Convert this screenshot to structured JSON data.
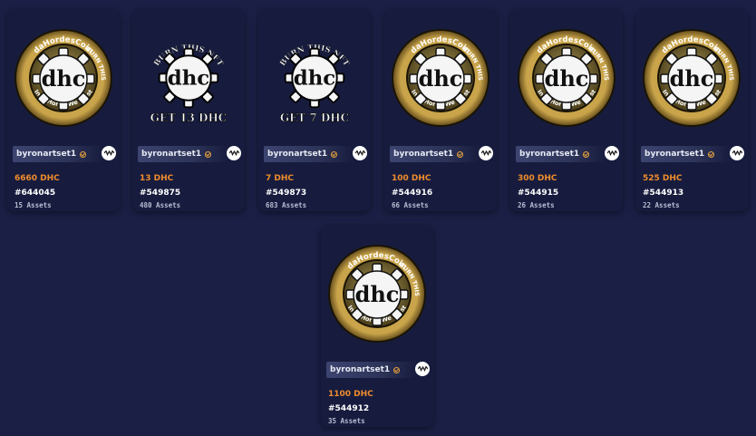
{
  "colors": {
    "background": "#1b1f45",
    "card": "#171c3e",
    "price": "#f08c2c",
    "verified": "#e8a33a"
  },
  "cards": [
    {
      "author": "byronartset1",
      "price": "6660 DHC",
      "template": "#644045",
      "assets": "15 Assets",
      "image": "gold-dhc-coin",
      "coin_top": "daHordesCoin",
      "coin_side": "BURN THIS",
      "coin_bottom": "In daHorde We Trust"
    },
    {
      "author": "byronartset1",
      "price": "13 DHC",
      "template": "#549875",
      "assets": "480 Assets",
      "image": "bw-dhc-burn",
      "burn_top": "BURN THIS NFT",
      "burn_bottom": "GET 13 DHC"
    },
    {
      "author": "byronartset1",
      "price": "7 DHC",
      "template": "#549873",
      "assets": "683 Assets",
      "image": "bw-dhc-burn",
      "burn_top": "BURN THIS NFT",
      "burn_bottom": "GET 7 DHC"
    },
    {
      "author": "byronartset1",
      "price": "100 DHC",
      "template": "#544916",
      "assets": "66 Assets",
      "image": "gold-dhc-coin",
      "coin_top": "daHordesCoin",
      "coin_side": "BURN THIS",
      "coin_bottom": "In daHorde We Trust"
    },
    {
      "author": "byronartset1",
      "price": "300 DHC",
      "template": "#544915",
      "assets": "26 Assets",
      "image": "gold-dhc-coin",
      "coin_top": "daHordesCoin",
      "coin_side": "BURN THIS",
      "coin_bottom": "In daHorde We Trust"
    },
    {
      "author": "byronartset1",
      "price": "525 DHC",
      "template": "#544913",
      "assets": "22 Assets",
      "image": "gold-dhc-coin",
      "coin_top": "daHordesCoin",
      "coin_side": "BURN THIS",
      "coin_bottom": "In daHorde We Trust"
    },
    {
      "author": "byronartset1",
      "price": "1100 DHC",
      "template": "#544912",
      "assets": "35 Assets",
      "image": "gold-dhc-coin",
      "coin_top": "daHordesCoin",
      "coin_side": "BURN THIS",
      "coin_bottom": "In daHorde We Trust"
    }
  ]
}
